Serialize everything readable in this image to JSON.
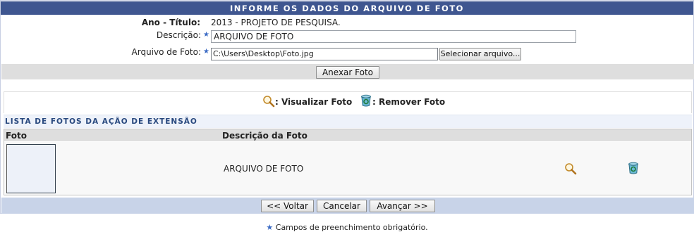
{
  "title": "Informe os dados do arquivo de foto",
  "form": {
    "ano_titulo_label": "Ano - Título:",
    "ano_titulo_value": "2013 - PROJETO DE PESQUISA.",
    "descricao_label": "Descrição:",
    "descricao_value": "ARQUIVO DE FOTO",
    "arquivo_label": "Arquivo de Foto:",
    "arquivo_value": "C:\\Users\\Desktop\\Foto.jpg",
    "select_file_label": "Selecionar arquivo...",
    "anexar_label": "Anexar Foto"
  },
  "legend": {
    "view_label": ": Visualizar Foto",
    "remove_label": ": Remover Foto"
  },
  "list": {
    "title": "Lista de fotos da ação de extensão",
    "col_foto": "Foto",
    "col_descricao": "Descrição da Foto",
    "rows": [
      {
        "descricao": "ARQUIVO DE FOTO"
      }
    ]
  },
  "buttons": {
    "voltar": "<< Voltar",
    "cancelar": "Cancelar",
    "avancar": "Avançar >>"
  },
  "footer_note": "Campos de preenchimento obrigatório.",
  "colors": {
    "title_bar": "#3f5690",
    "section_title_text": "#28487e",
    "footer_bar": "#c8d3e8",
    "required_star": "#3a6ac4"
  },
  "icons": {
    "view": "magnifier-icon",
    "remove": "trash-icon"
  }
}
